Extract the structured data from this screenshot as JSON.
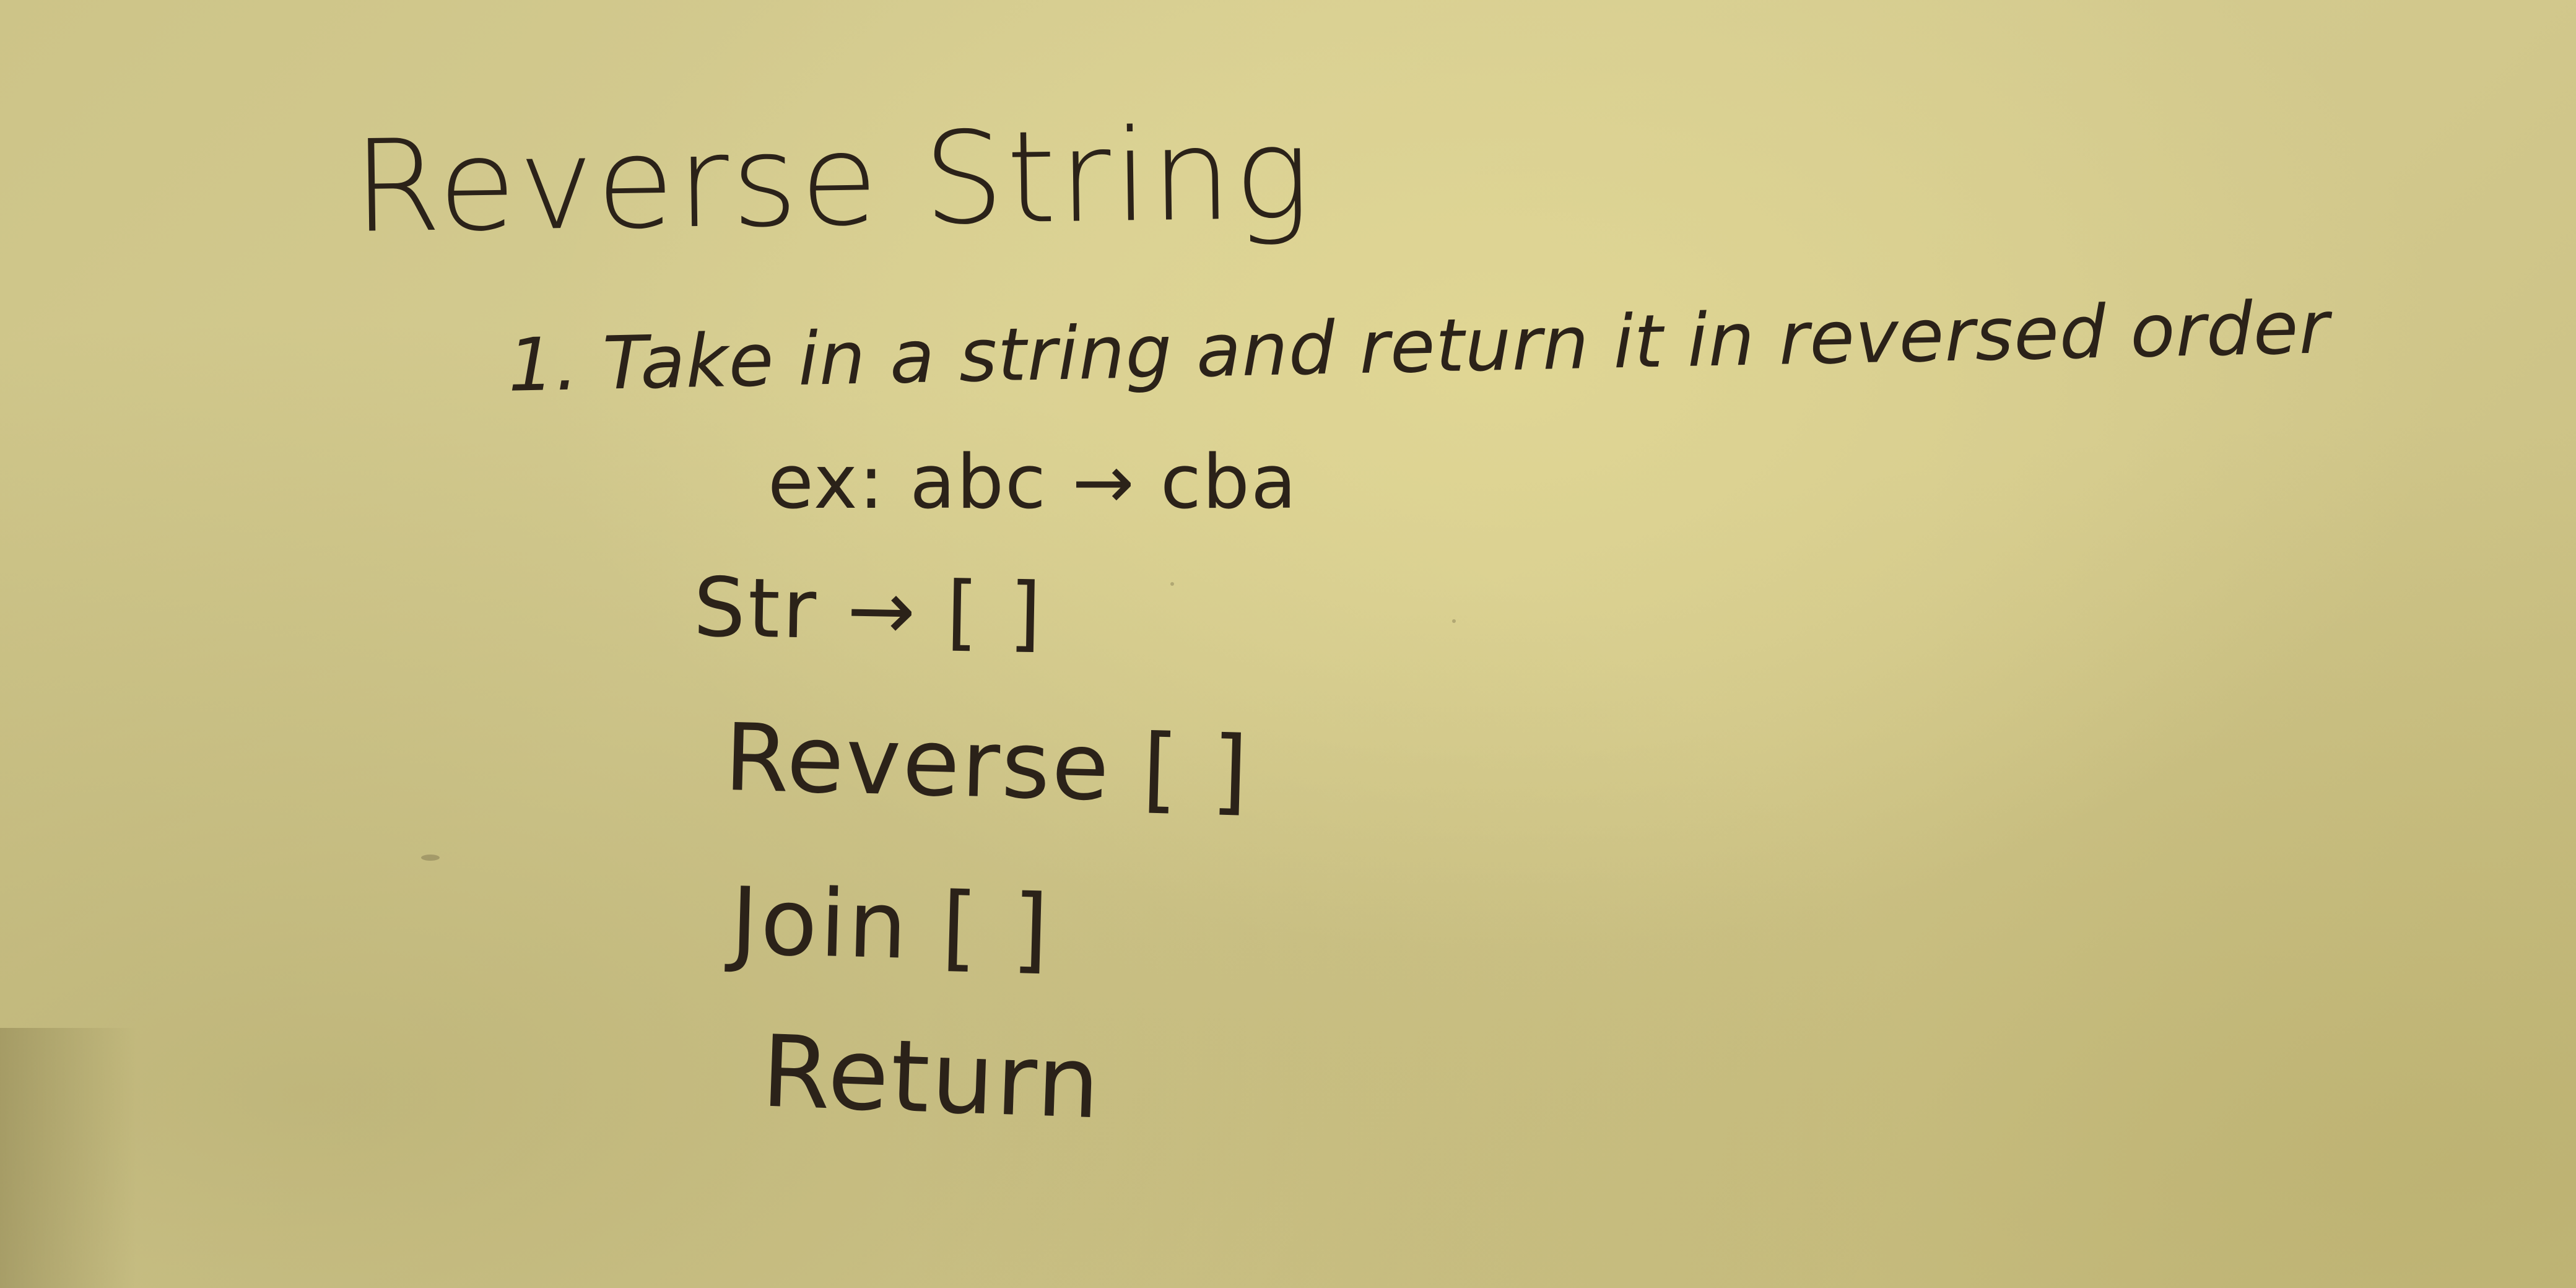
{
  "whiteboard": {
    "title": "Reverse String",
    "step": "1. Take in a string and return it in reversed order",
    "example": "ex:  abc → cba",
    "steps": [
      "Str → [ ]",
      "Reverse [ ]",
      "Join [ ]",
      "Return"
    ]
  },
  "colors": {
    "board": "#d3ca8e",
    "ink": "#2b2219"
  }
}
